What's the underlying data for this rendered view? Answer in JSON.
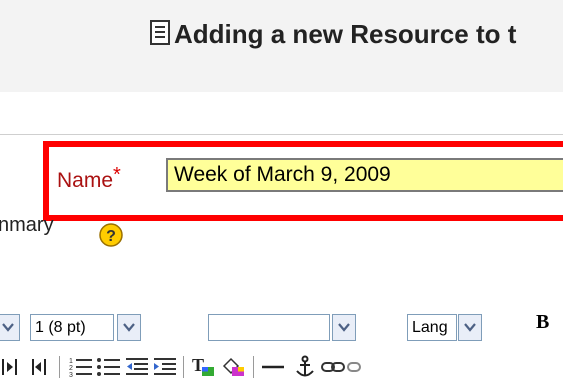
{
  "header": {
    "title": "Adding a new Resource to t",
    "icon": "document-icon"
  },
  "form": {
    "name_label": "Name",
    "required_marker": "*",
    "name_value": "Week of March 9, 2009",
    "summary_label": "nmary",
    "help_icon": "help-icon"
  },
  "toolbar": {
    "font_size_value": "1 (8 pt)",
    "format_value": "",
    "lang_value": "Lang",
    "bold_label": "B",
    "icons": [
      "ltr-icon",
      "rtl-icon",
      "ordered-list-icon",
      "unordered-list-icon",
      "outdent-icon",
      "indent-icon",
      "text-color-icon",
      "background-color-icon",
      "horizontal-rule-icon",
      "anchor-icon",
      "link-icon",
      "unlink-icon"
    ]
  },
  "colors": {
    "highlight": "#ff0000",
    "input_background": "#ffff99",
    "label_red": "#aa1111"
  }
}
